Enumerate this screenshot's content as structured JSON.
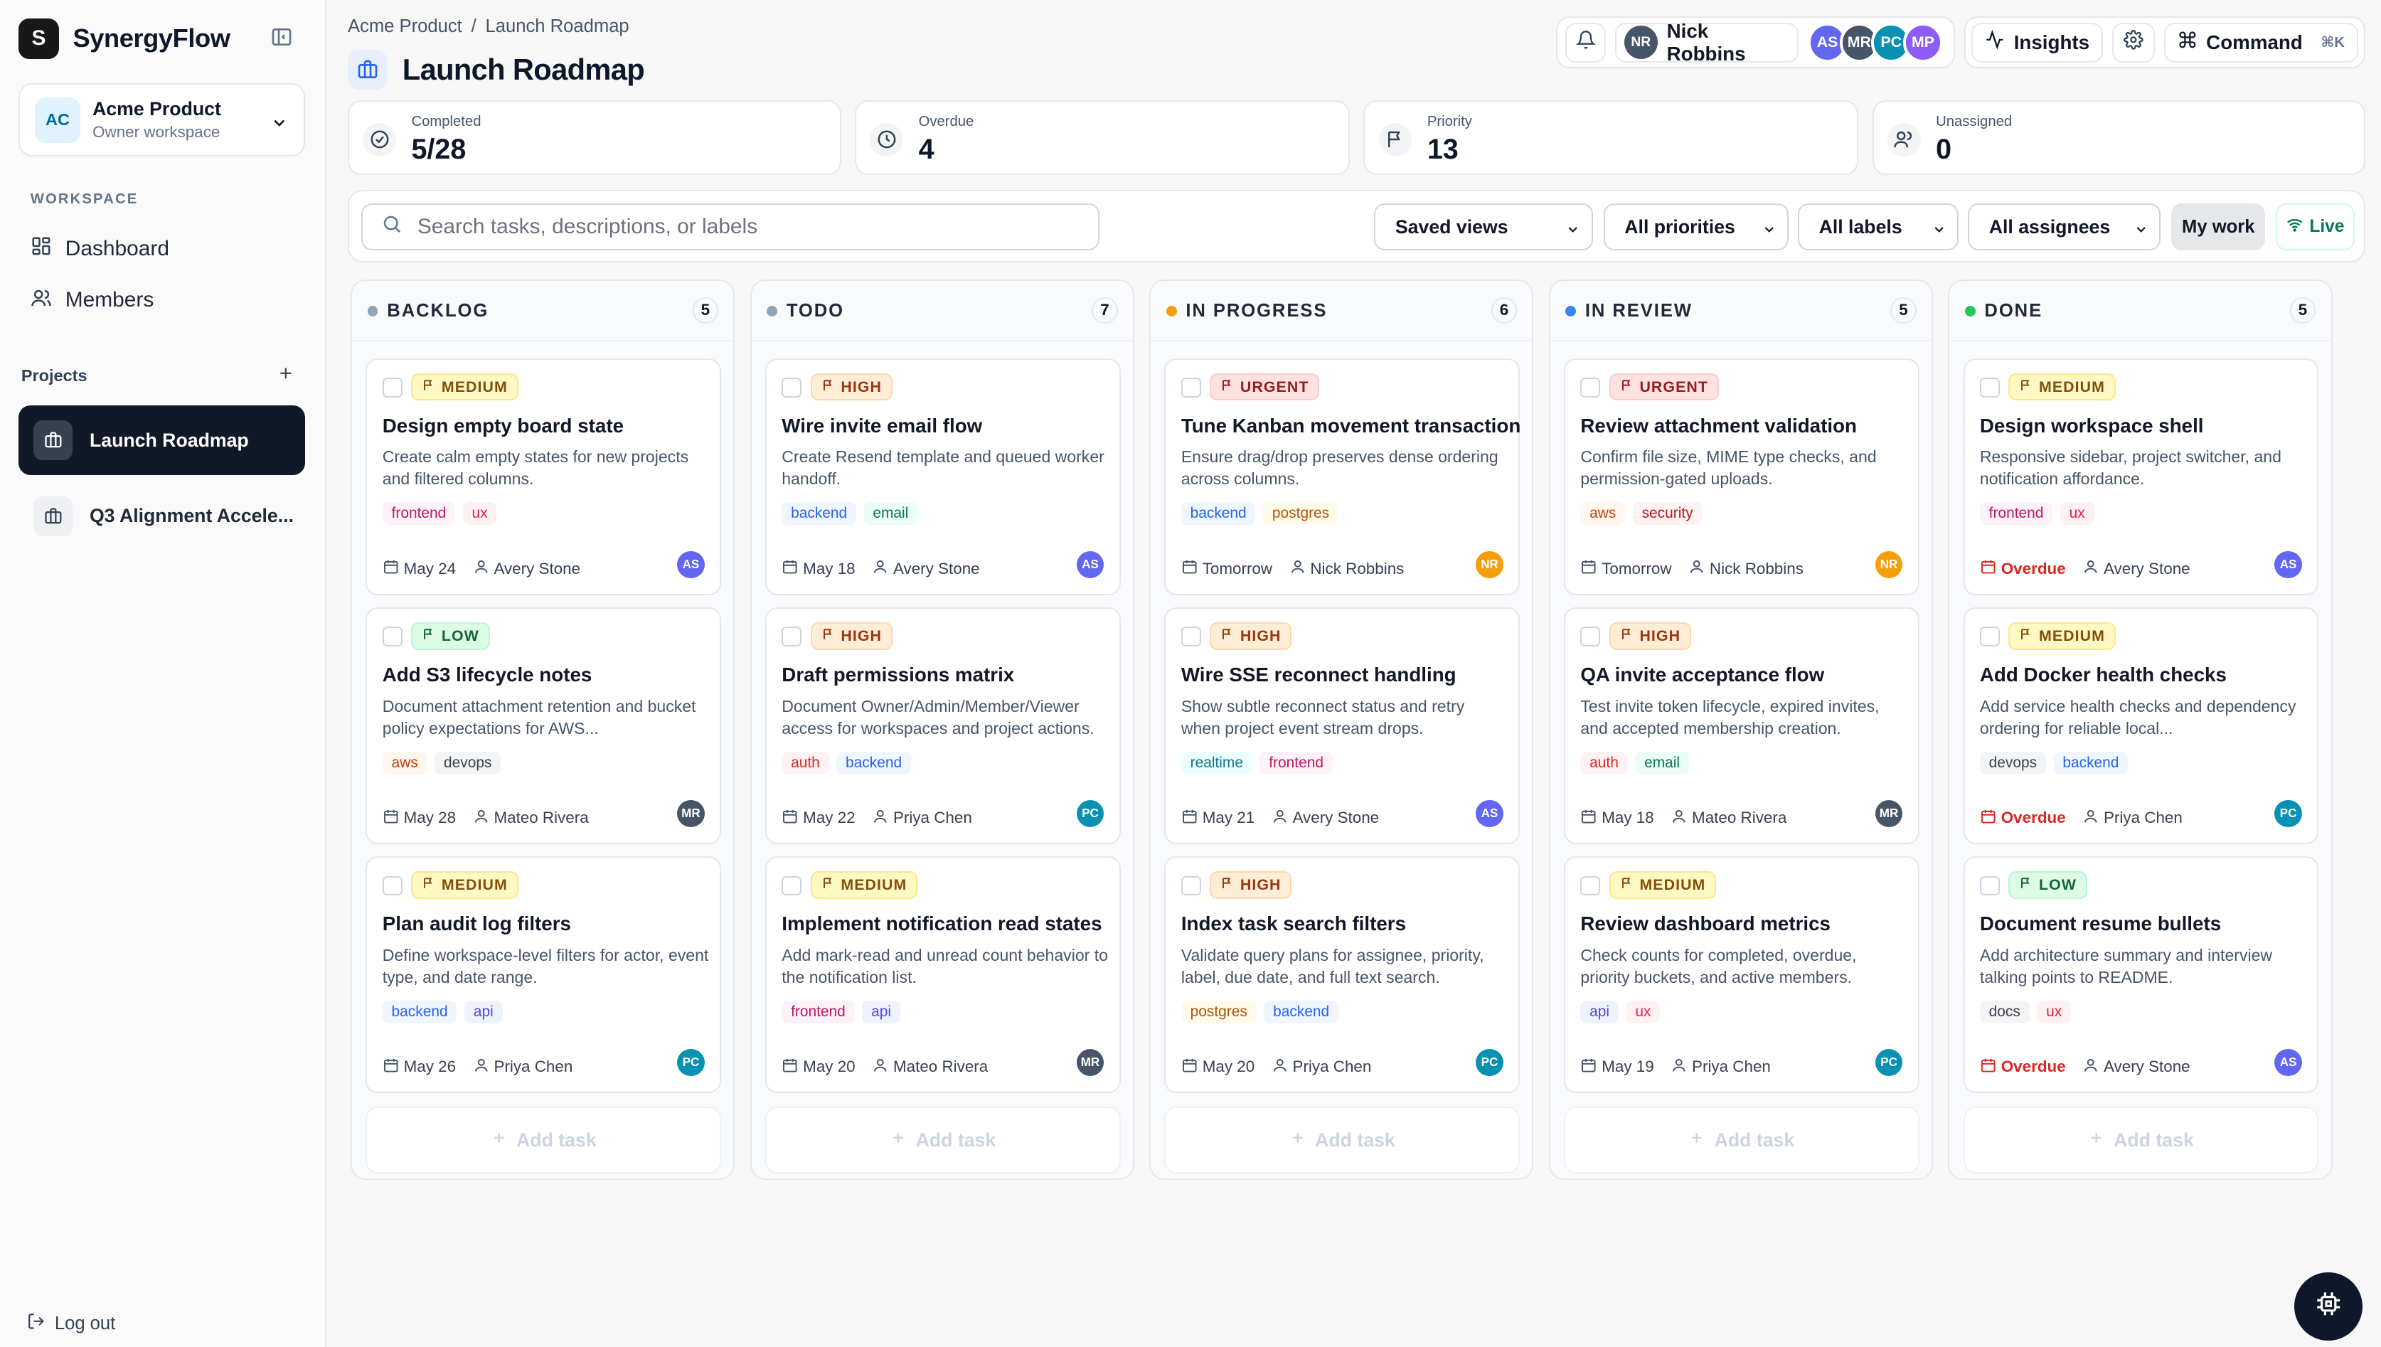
{
  "app": {
    "logo_letter": "S",
    "name": "SynergyFlow"
  },
  "workspace": {
    "initials": "AC",
    "name": "Acme Product",
    "role": "Owner workspace",
    "section_label": "WORKSPACE",
    "nav": [
      {
        "label": "Dashboard",
        "icon": "dashboard-icon"
      },
      {
        "label": "Members",
        "icon": "members-icon"
      }
    ]
  },
  "projects": {
    "label": "Projects",
    "items": [
      {
        "label": "Launch Roadmap",
        "active": true
      },
      {
        "label": "Q3 Alignment Accele...",
        "active": false
      }
    ]
  },
  "logout_label": "Log out",
  "breadcrumb": [
    "Acme Product",
    "/",
    "Launch Roadmap"
  ],
  "page_title": "Launch Roadmap",
  "topbar": {
    "user_initials": "NR",
    "user_name": "Nick Robbins",
    "member_avatars": [
      {
        "initials": "AS",
        "color": "#6366f1"
      },
      {
        "initials": "MR",
        "color": "#475569"
      },
      {
        "initials": "PC",
        "color": "#0891b2"
      },
      {
        "initials": "MP",
        "color": "#8b5cf6"
      }
    ],
    "insights_label": "Insights",
    "command_label": "Command",
    "command_shortcut": "⌘K"
  },
  "stats": [
    {
      "label": "Completed",
      "value": "5/28",
      "icon": "check-circle-icon"
    },
    {
      "label": "Overdue",
      "value": "4",
      "icon": "clock-icon"
    },
    {
      "label": "Priority",
      "value": "13",
      "icon": "flag-icon"
    },
    {
      "label": "Unassigned",
      "value": "0",
      "icon": "users-icon"
    }
  ],
  "filters": {
    "search_placeholder": "Search tasks, descriptions, or labels",
    "saved_views": "Saved views",
    "priorities": "All priorities",
    "labels": "All labels",
    "assignees": "All assignees",
    "my_work": "My work",
    "live": "Live"
  },
  "add_task_label": "Add task",
  "colors": {
    "accent": "#111827",
    "backlog": "#94a3b8",
    "todo": "#94a3b8",
    "in_progress": "#f59e0b",
    "in_review": "#3b82f6",
    "done": "#22c55e",
    "overdue": "#dc2626"
  },
  "columns": [
    {
      "key": "backlog",
      "title": "BACKLOG",
      "count": "5",
      "dot": "#94a3b8",
      "cards": [
        {
          "priority": "MEDIUM",
          "level": "medium",
          "title": "Design empty board state",
          "desc": "Create calm empty states for new projects and filtered columns.",
          "labels": [
            "frontend",
            "ux"
          ],
          "due": "May 24",
          "overdue": false,
          "assignee": "Avery Stone",
          "initials": "AS"
        },
        {
          "priority": "LOW",
          "level": "low",
          "title": "Add S3 lifecycle notes",
          "desc": "Document attachment retention and bucket policy expectations for AWS...",
          "labels": [
            "aws",
            "devops"
          ],
          "due": "May 28",
          "overdue": false,
          "assignee": "Mateo Rivera",
          "initials": "MR"
        },
        {
          "priority": "MEDIUM",
          "level": "medium",
          "title": "Plan audit log filters",
          "desc": "Define workspace-level filters for actor, event type, and date range.",
          "labels": [
            "backend",
            "api"
          ],
          "due": "May 26",
          "overdue": false,
          "assignee": "Priya Chen",
          "initials": "PC"
        }
      ]
    },
    {
      "key": "todo",
      "title": "TODO",
      "count": "7",
      "dot": "#94a3b8",
      "cards": [
        {
          "priority": "HIGH",
          "level": "high",
          "title": "Wire invite email flow",
          "desc": "Create Resend template and queued worker handoff.",
          "labels": [
            "backend",
            "email"
          ],
          "due": "May 18",
          "overdue": false,
          "assignee": "Avery Stone",
          "initials": "AS"
        },
        {
          "priority": "HIGH",
          "level": "high",
          "title": "Draft permissions matrix",
          "desc": "Document Owner/Admin/Member/Viewer access for workspaces and project actions.",
          "labels": [
            "auth",
            "backend"
          ],
          "due": "May 22",
          "overdue": false,
          "assignee": "Priya Chen",
          "initials": "PC"
        },
        {
          "priority": "MEDIUM",
          "level": "medium",
          "title": "Implement notification read states",
          "desc": "Add mark-read and unread count behavior to the notification list.",
          "labels": [
            "frontend",
            "api"
          ],
          "due": "May 20",
          "overdue": false,
          "assignee": "Mateo Rivera",
          "initials": "MR"
        }
      ]
    },
    {
      "key": "in_progress",
      "title": "IN PROGRESS",
      "count": "6",
      "dot": "#f59e0b",
      "cards": [
        {
          "priority": "URGENT",
          "level": "urgent",
          "title": "Tune Kanban movement transaction",
          "desc": "Ensure drag/drop preserves dense ordering across columns.",
          "labels": [
            "backend",
            "postgres"
          ],
          "due": "Tomorrow",
          "overdue": false,
          "assignee": "Nick Robbins",
          "initials": "NR"
        },
        {
          "priority": "HIGH",
          "level": "high",
          "title": "Wire SSE reconnect handling",
          "desc": "Show subtle reconnect status and retry when project event stream drops.",
          "labels": [
            "realtime",
            "frontend"
          ],
          "due": "May 21",
          "overdue": false,
          "assignee": "Avery Stone",
          "initials": "AS"
        },
        {
          "priority": "HIGH",
          "level": "high",
          "title": "Index task search filters",
          "desc": "Validate query plans for assignee, priority, label, due date, and full text search.",
          "labels": [
            "postgres",
            "backend"
          ],
          "due": "May 20",
          "overdue": false,
          "assignee": "Priya Chen",
          "initials": "PC"
        }
      ]
    },
    {
      "key": "in_review",
      "title": "IN REVIEW",
      "count": "5",
      "dot": "#3b82f6",
      "cards": [
        {
          "priority": "URGENT",
          "level": "urgent",
          "title": "Review attachment validation",
          "desc": "Confirm file size, MIME type checks, and permission-gated uploads.",
          "labels": [
            "aws",
            "security"
          ],
          "due": "Tomorrow",
          "overdue": false,
          "assignee": "Nick Robbins",
          "initials": "NR"
        },
        {
          "priority": "HIGH",
          "level": "high",
          "title": "QA invite acceptance flow",
          "desc": "Test invite token lifecycle, expired invites, and accepted membership creation.",
          "labels": [
            "auth",
            "email"
          ],
          "due": "May 18",
          "overdue": false,
          "assignee": "Mateo Rivera",
          "initials": "MR"
        },
        {
          "priority": "MEDIUM",
          "level": "medium",
          "title": "Review dashboard metrics",
          "desc": "Check counts for completed, overdue, priority buckets, and active members.",
          "labels": [
            "api",
            "ux"
          ],
          "due": "May 19",
          "overdue": false,
          "assignee": "Priya Chen",
          "initials": "PC"
        }
      ]
    },
    {
      "key": "done",
      "title": "DONE",
      "count": "5",
      "dot": "#22c55e",
      "cards": [
        {
          "priority": "MEDIUM",
          "level": "medium",
          "title": "Design workspace shell",
          "desc": "Responsive sidebar, project switcher, and notification affordance.",
          "labels": [
            "frontend",
            "ux"
          ],
          "due": "Overdue",
          "overdue": true,
          "assignee": "Avery Stone",
          "initials": "AS"
        },
        {
          "priority": "MEDIUM",
          "level": "medium",
          "title": "Add Docker health checks",
          "desc": "Add service health checks and dependency ordering for reliable local...",
          "labels": [
            "devops",
            "backend"
          ],
          "due": "Overdue",
          "overdue": true,
          "assignee": "Priya Chen",
          "initials": "PC"
        },
        {
          "priority": "LOW",
          "level": "low",
          "title": "Document resume bullets",
          "desc": "Add architecture summary and interview talking points to README.",
          "labels": [
            "docs",
            "ux"
          ],
          "due": "Overdue",
          "overdue": true,
          "assignee": "Avery Stone",
          "initials": "AS"
        }
      ]
    }
  ]
}
